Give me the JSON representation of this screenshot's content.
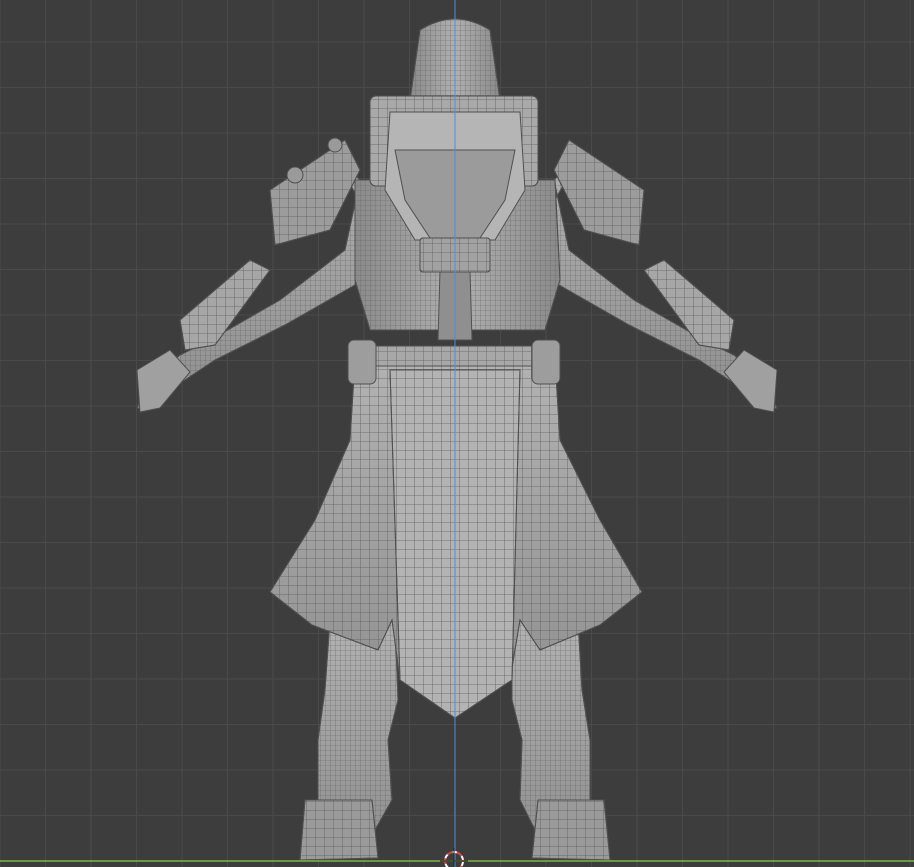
{
  "viewport": {
    "view": "back-orthographic",
    "shading": "solid-wireframe",
    "colors": {
      "background": "#3d3d3d",
      "grid_minor": "#4a4a4a",
      "grid_major": "#555555",
      "z_axis": "#4f8fd6",
      "x_axis": "#7fb548",
      "mesh_fill": "#a4a4a4",
      "mesh_shadow": "#6f6f6f",
      "wire": "#5a5a5a",
      "cursor_ring": "#d24a4a"
    },
    "object": {
      "type": "character-mesh",
      "parts": [
        "helmet",
        "backpack",
        "pauldrons",
        "arms",
        "hands",
        "belt",
        "coat-tails",
        "legs",
        "boots"
      ]
    },
    "cursor": "3d-cursor"
  }
}
